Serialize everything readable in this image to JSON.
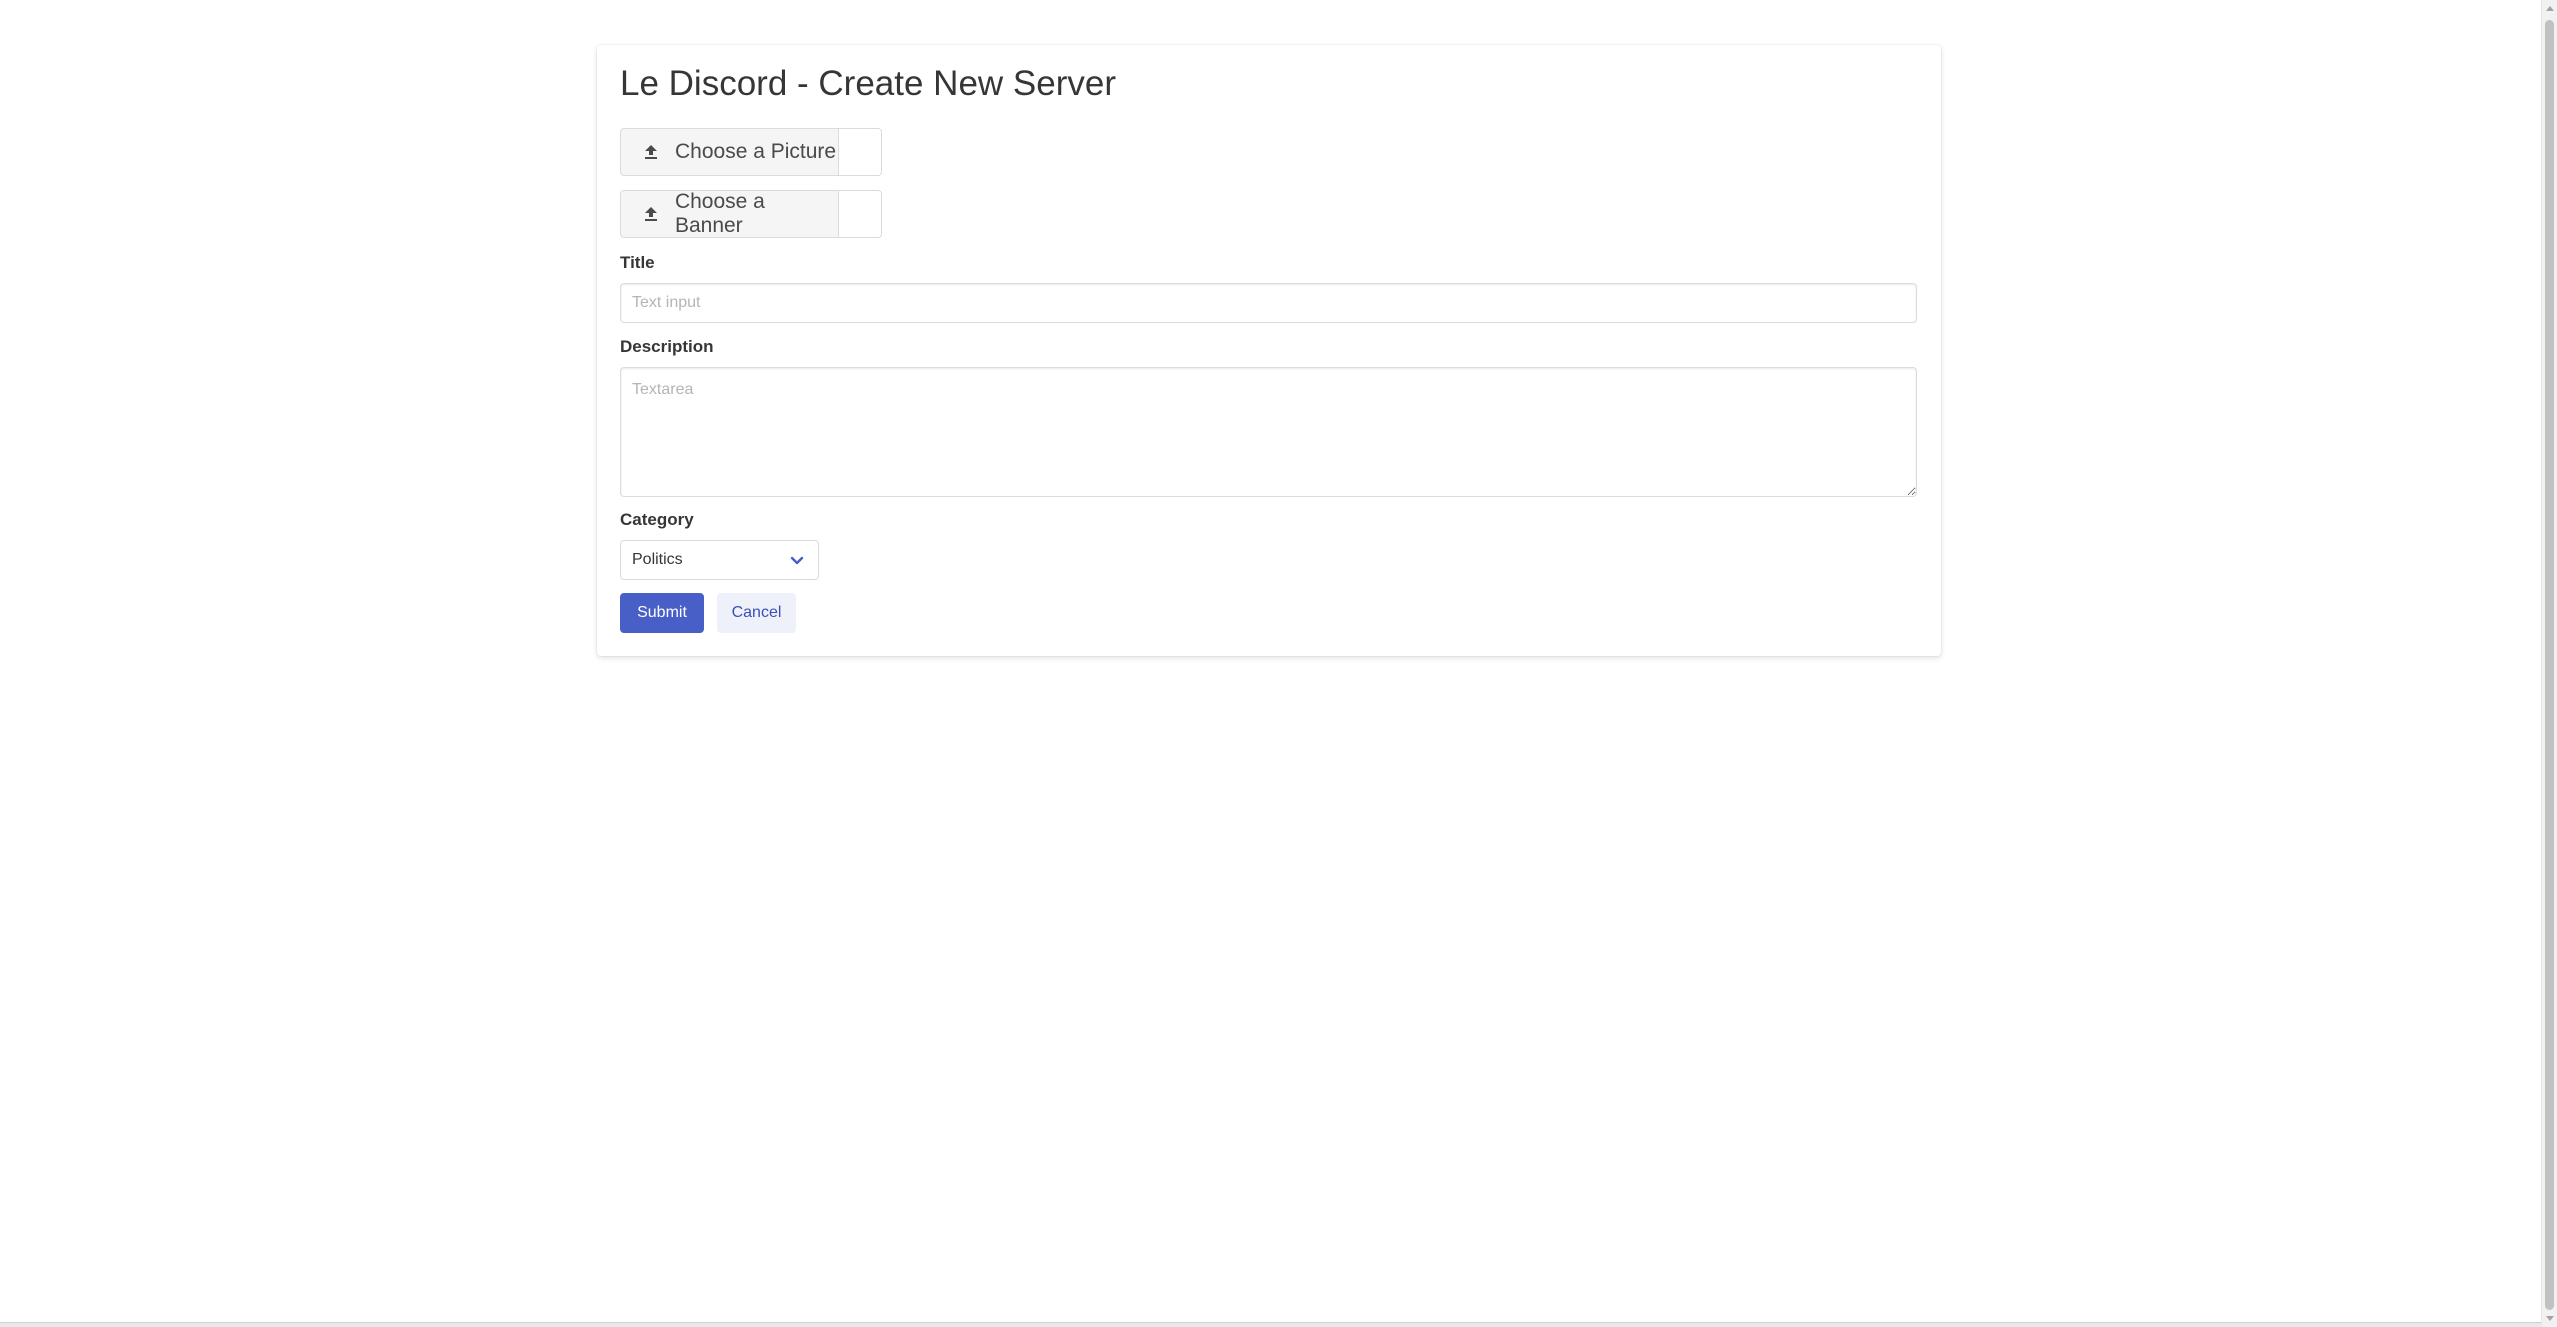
{
  "page": {
    "title": "Le Discord - Create New Server"
  },
  "uploads": {
    "picture_label": "Choose a Picture",
    "banner_label": "Choose a Banner"
  },
  "fields": {
    "title_label": "Title",
    "title_placeholder": "Text input",
    "description_label": "Description",
    "description_placeholder": "Textarea",
    "category_label": "Category",
    "category_selected": "Politics"
  },
  "actions": {
    "submit_label": "Submit",
    "cancel_label": "Cancel"
  },
  "colors": {
    "primary": "#485fc7",
    "cancel_bg": "#eff1fa",
    "cancel_text": "#3850b7"
  },
  "icons": {
    "upload": "upload-icon",
    "select_chevron": "chevron-down-icon"
  }
}
